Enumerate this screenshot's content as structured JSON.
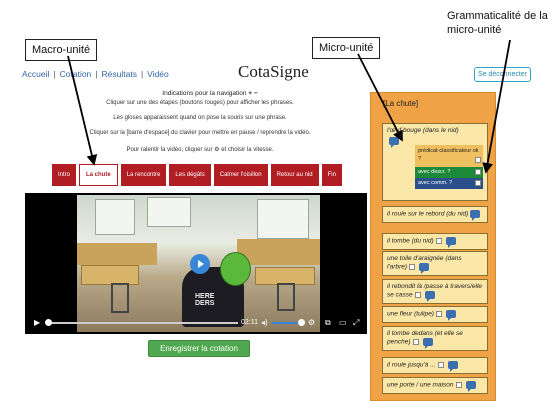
{
  "annotations": {
    "macro": "Macro-unité",
    "micro": "Micro-unité",
    "gram": "Grammaticalité de la micro-unité"
  },
  "nav": {
    "items": [
      "Accueil",
      "Cotation",
      "Résultats",
      "Vidéo"
    ],
    "brand": "CotaSigne",
    "logout": "Se déconnecter"
  },
  "instructions": {
    "title": "Indications pour la navigation",
    "lines": [
      "Cliquer sur une des étapes (boutons rouges) pour afficher les phrases.",
      "Les gloses apparaissent quand on pose la souris sur une phrase.",
      "Cliquer sur la [barre d'espace] du clavier pour mettre en pause / reprendre la vidéo.",
      "Pour ralentir la vidéo, cliquer sur ⚙ et choisir la vitesse."
    ]
  },
  "steps": [
    "Intro",
    "La chute",
    "La rencontre",
    "Les dégâts",
    "Calmer l'oisillon",
    "Retour au nid",
    "Fin"
  ],
  "active_step": "La chute",
  "video": {
    "shirt_text": "HERE\nDERS",
    "time": "02:11"
  },
  "save_label": "Enregistrer la cotation",
  "panel": {
    "title": "[La chute]",
    "first_card": {
      "text": "l'œuf bouge (dans le nid)",
      "sub": [
        "prédicat-classificateur ok ?",
        "avec descr. ?",
        "avec comm. ?"
      ]
    },
    "cards": [
      "il roule sur le rebord (du nid)",
      "il tombe (du nid)",
      "une toile d'araignée (dans l'arbre)",
      "il rebondit là /passe à travers/elle se casse",
      "une fleur (tulipe)",
      "il tombe dedans (et elle se penche)",
      "il roule jusqu'à ...",
      "une porte / une maison"
    ]
  }
}
